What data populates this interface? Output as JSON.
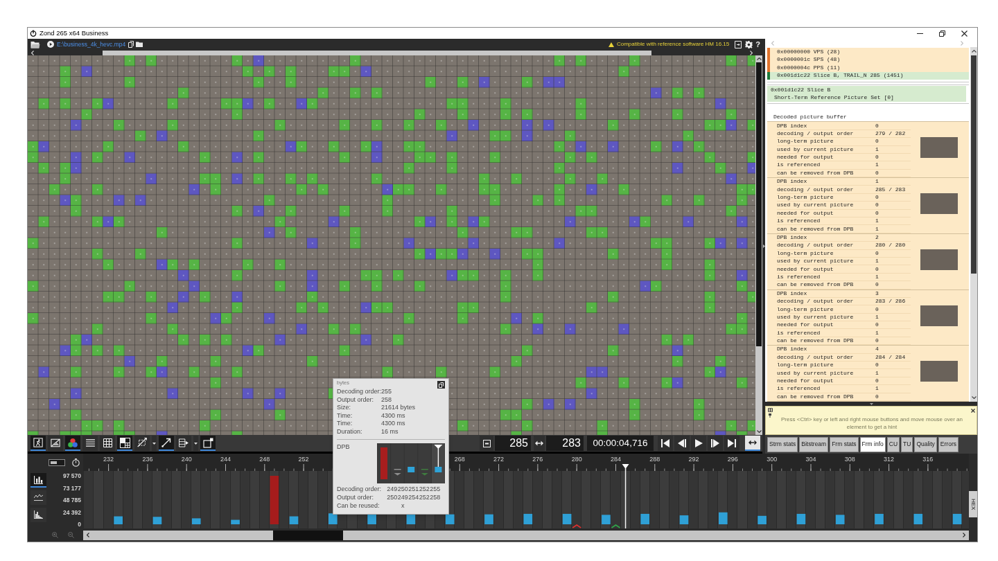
{
  "window": {
    "title": "Zond 265 x64 Business"
  },
  "file_toolbar": {
    "file_path": "E:\\business_4k_hevc.mp4",
    "status": "Compatible with reference software HM 16.15",
    "help_label": "?"
  },
  "view_toolbar": [
    {
      "kind": "toggle",
      "active": true
    },
    {
      "kind": "toggle",
      "active": false
    },
    {
      "kind": "toggle",
      "active": true
    },
    {
      "kind": "toggle",
      "active": false
    },
    {
      "kind": "toggle",
      "active": false
    },
    {
      "kind": "toggle",
      "active": true
    },
    {
      "kind": "toggle",
      "active": false
    },
    {
      "kind": "dropdown"
    },
    {
      "kind": "toggle",
      "active": true
    },
    {
      "kind": "toggle",
      "active": false
    },
    {
      "kind": "dropdown"
    },
    {
      "kind": "toggle",
      "active": true
    }
  ],
  "frame_controls": {
    "decode_frame": "285",
    "display_frame": "283",
    "timecode": "00:00:04,716",
    "fit_active": true
  },
  "stream_panel": {
    "nal_units": [
      {
        "kind": "parameter_set",
        "text": "0x00000000 VPS (28)"
      },
      {
        "kind": "parameter_set",
        "text": "0x0000001c SPS (48)"
      },
      {
        "kind": "parameter_set",
        "text": "0x0000004c PPS (11)"
      },
      {
        "kind": "slice",
        "text": "0x001d1c22 Slice B, TRAIL_N 285 (1451)"
      }
    ],
    "slice_tree": [
      {
        "text": "0x001d1c22 Slice B",
        "children": [
          {
            "text": "Short-Term Reference Picture Set [0]"
          }
        ]
      }
    ],
    "dpb": {
      "title": "Decoded picture buffer",
      "entries": [
        {
          "fields": [
            {
              "label": "DPB index",
              "value": "0"
            },
            {
              "label": "decoding / output order",
              "value": "279 / 282"
            },
            {
              "label": "long-term picture",
              "value": "0"
            },
            {
              "label": "used by current picture",
              "value": "1"
            },
            {
              "label": "needed for output",
              "value": "0"
            },
            {
              "label": "is referenced",
              "value": "1"
            },
            {
              "label": "can be removed from DPB",
              "value": "0"
            }
          ]
        },
        {
          "fields": [
            {
              "label": "DPB index",
              "value": "1"
            },
            {
              "label": "decoding / output order",
              "value": "285 / 283"
            },
            {
              "label": "long-term picture",
              "value": "0"
            },
            {
              "label": "used by current picture",
              "value": "0"
            },
            {
              "label": "needed for output",
              "value": "0"
            },
            {
              "label": "is referenced",
              "value": "1"
            },
            {
              "label": "can be removed from DPB",
              "value": "1"
            }
          ]
        },
        {
          "fields": [
            {
              "label": "DPB index",
              "value": "2"
            },
            {
              "label": "decoding / output order",
              "value": "280 / 280"
            },
            {
              "label": "long-term picture",
              "value": "0"
            },
            {
              "label": "used by current picture",
              "value": "1"
            },
            {
              "label": "needed for output",
              "value": "0"
            },
            {
              "label": "is referenced",
              "value": "1"
            },
            {
              "label": "can be removed from DPB",
              "value": "0"
            }
          ]
        },
        {
          "fields": [
            {
              "label": "DPB index",
              "value": "3"
            },
            {
              "label": "decoding / output order",
              "value": "283 / 286"
            },
            {
              "label": "long-term picture",
              "value": "0"
            },
            {
              "label": "used by current picture",
              "value": "1"
            },
            {
              "label": "needed for output",
              "value": "0"
            },
            {
              "label": "is referenced",
              "value": "1"
            },
            {
              "label": "can be removed from DPB",
              "value": "0"
            }
          ]
        },
        {
          "fields": [
            {
              "label": "DPB index",
              "value": "4"
            },
            {
              "label": "decoding / output order",
              "value": "284 / 284"
            },
            {
              "label": "long-term picture",
              "value": "0"
            },
            {
              "label": "used by current picture",
              "value": "1"
            },
            {
              "label": "needed for output",
              "value": "0"
            },
            {
              "label": "is referenced",
              "value": "1"
            },
            {
              "label": "can be removed from DPB",
              "value": "0"
            }
          ]
        }
      ]
    }
  },
  "hint": {
    "text": "Press <Ctrl> key or left and right mouse buttons and move mouse over an element to get a hint"
  },
  "tabs": [
    {
      "label": "Strm stats",
      "selected": false
    },
    {
      "label": "Bitstream",
      "selected": false
    },
    {
      "label": "Frm stats",
      "selected": false
    },
    {
      "label": "Frm info",
      "selected": true
    },
    {
      "label": "CU",
      "selected": false
    },
    {
      "label": "TU",
      "selected": false
    },
    {
      "label": "Quality",
      "selected": false
    },
    {
      "label": "Errors",
      "selected": false
    }
  ],
  "timeline": {
    "graph_modes": [
      {
        "selected": true
      },
      {
        "selected": false
      },
      {
        "selected": false
      }
    ],
    "side_tab": "HEX",
    "chart_data": {
      "type": "bar",
      "x": [
        233,
        237,
        241,
        245,
        249,
        251,
        255,
        259,
        263,
        267,
        271,
        275,
        279,
        283,
        287,
        291,
        295,
        299,
        303,
        307,
        311,
        315,
        319
      ],
      "series": [
        {
          "color": "#a51c1c",
          "values": [
            null,
            null,
            null,
            null,
            97570,
            null,
            null,
            null,
            null,
            null,
            null,
            null,
            null,
            null,
            null,
            null,
            null,
            null,
            null,
            null,
            null,
            null,
            null
          ]
        },
        {
          "color": "#2fa0d6",
          "values": [
            16000,
            15000,
            12000,
            9000,
            null,
            16000,
            22000,
            22000,
            20000,
            20000,
            20000,
            21000,
            21000,
            19000,
            21000,
            18000,
            24000,
            17000,
            21000,
            19000,
            21000,
            21000,
            21000
          ]
        }
      ],
      "xlim": [
        229.4,
        320.2
      ],
      "ylim": [
        0,
        97570
      ],
      "xticks": [
        232,
        236,
        240,
        244,
        248,
        252,
        268,
        272,
        276,
        280,
        284,
        288,
        292,
        296,
        300,
        304,
        308,
        312,
        316
      ],
      "yticks": [
        {
          "value": 0,
          "label": "0"
        },
        {
          "value": 24392,
          "label": "24 392"
        },
        {
          "value": 48785,
          "label": "48 785"
        },
        {
          "value": 73177,
          "label": "73 177"
        },
        {
          "value": 97570,
          "label": "97 570"
        }
      ],
      "ref_lines": [
        {
          "axis": "x",
          "value": 285
        }
      ]
    }
  },
  "popup": {
    "title": "bytes",
    "fields": [
      {
        "label": "Decoding order:",
        "value": "255"
      },
      {
        "label": "Output order:",
        "value": "258"
      },
      {
        "label": "Size:",
        "value": "21614 bytes"
      },
      {
        "label": "Time:",
        "value": "4300 ms"
      },
      {
        "label": "Time:",
        "value": "4300 ms"
      },
      {
        "label": "Duration:",
        "value": "16 ms"
      }
    ],
    "dpb": {
      "label": "DPB",
      "row_labels": [
        "Decoding order:",
        "Output order:",
        "Can be reused:"
      ],
      "slots": [
        {
          "kind": "bar",
          "color": "#a81e1e",
          "selected": false,
          "decoding_order": "249",
          "output_order": "250"
        },
        {
          "kind": "line",
          "color": "#8e8e8e",
          "selected": false,
          "decoding_order": "250",
          "output_order": "249",
          "can_be_reused": "x"
        },
        {
          "kind": "block",
          "color": "#2ea3d8",
          "selected": false,
          "decoding_order": "251",
          "output_order": "254"
        },
        {
          "kind": "line",
          "color": "#3f7c3f",
          "selected": false,
          "decoding_order": "252",
          "output_order": "252"
        },
        {
          "kind": "block",
          "color": "#2ea3d8",
          "selected": true,
          "decoding_order": "255",
          "output_order": "258"
        }
      ]
    }
  }
}
